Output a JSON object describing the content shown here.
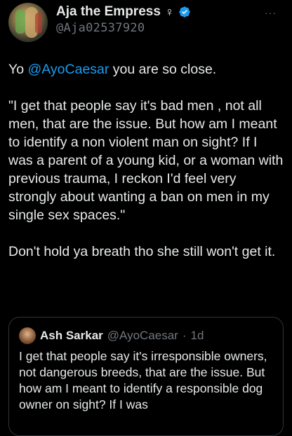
{
  "tweet": {
    "author_name": "Aja the Empress",
    "gender_symbol": "♀",
    "handle": "@Aja02537920",
    "more_label": "···",
    "p1_prefix": "Yo ",
    "p1_mention": "@AyoCaesar",
    "p1_suffix": " you are so close.",
    "p2": "\"I get that people say it's bad men , not all men, that are the issue. But how am I meant to identify a non violent man on sight? If I was a parent of a young kid, or a woman with previous trauma, I reckon I'd feel very strongly about wanting a ban on men in my single sex spaces.\"",
    "p3": "Don't hold ya breath tho she still won't get it."
  },
  "quote": {
    "author_name": "Ash Sarkar",
    "handle": "@AyoCaesar",
    "separator": "·",
    "time": "1d",
    "text": "I get that people say it's irresponsible owners, not dangerous breeds, that are the issue. But how am I meant to identify a responsible dog owner on sight? If I was"
  },
  "colors": {
    "background": "#000000",
    "text": "#e7e9ea",
    "secondary": "#71767b",
    "accent": "#1d9bf0"
  }
}
